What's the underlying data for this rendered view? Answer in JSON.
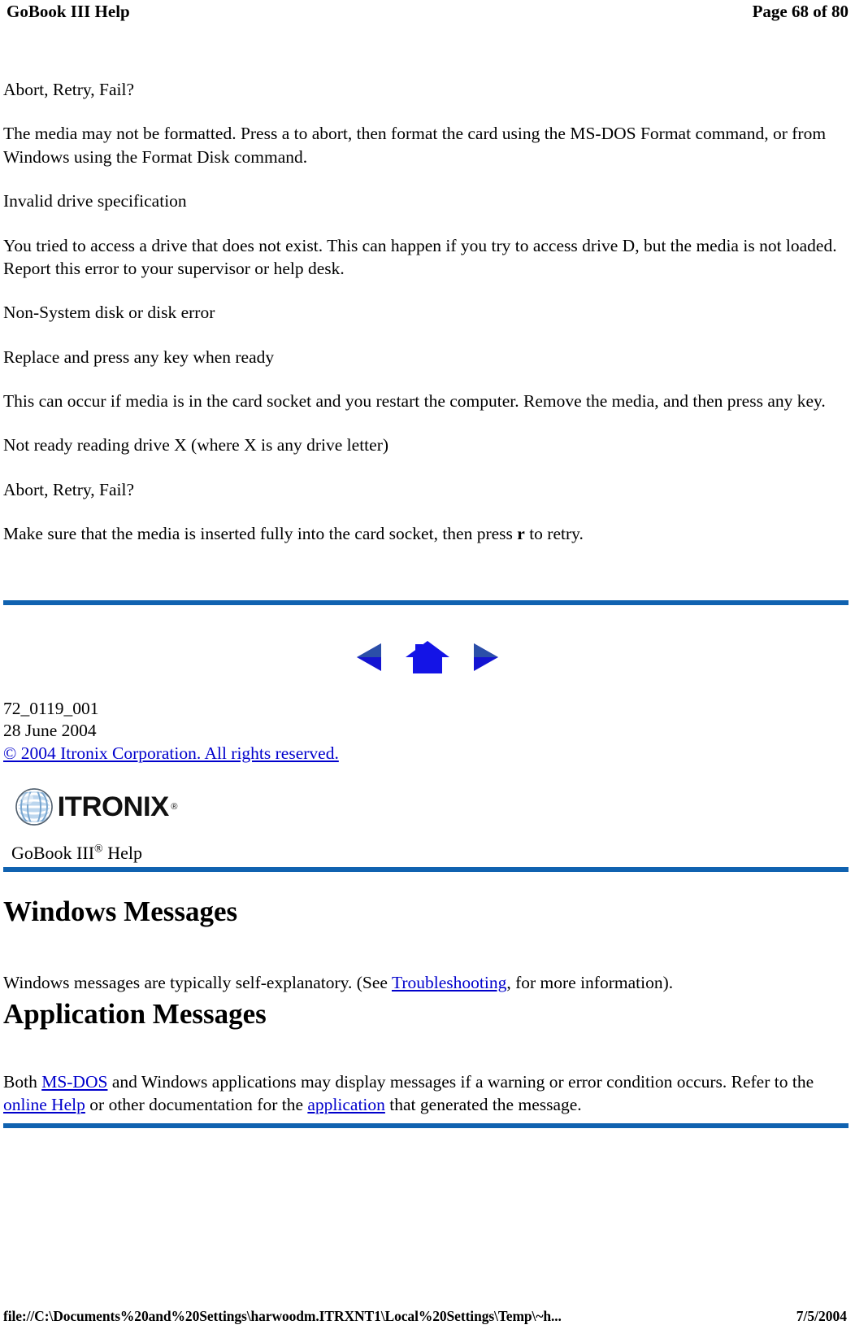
{
  "header": {
    "title": "GoBook III Help",
    "page_label": "Page 68 of 80"
  },
  "body_paragraphs": [
    {
      "id": "p1",
      "text": "Abort, Retry, Fail?"
    },
    {
      "id": "p2",
      "text": "The media may not be formatted. Press a to abort, then format the card using the MS-DOS Format command, or from Windows using the Format Disk command."
    },
    {
      "id": "p3",
      "text": "Invalid drive specification"
    },
    {
      "id": "p4",
      "text": "You tried to access a drive that does not exist. This can happen if you try to access drive D, but the media is not loaded. Report this error to your supervisor or help desk."
    },
    {
      "id": "p5",
      "text": "Non-System disk or disk error"
    },
    {
      "id": "p6",
      "text": "Replace and press any key when ready"
    },
    {
      "id": "p7",
      "text": "This can occur if media is in the card socket and you restart the computer. Remove the media, and then press any key."
    },
    {
      "id": "p8",
      "text": "Not ready reading drive X (where X is any drive letter)"
    },
    {
      "id": "p9",
      "text": "Abort, Retry, Fail?"
    }
  ],
  "retry_paragraph": {
    "before": "Make sure that the media is inserted fully into the card socket, then press ",
    "key": "r",
    "after": " to retry."
  },
  "navigation": {
    "back_icon": "back-triangle-icon",
    "home_icon": "home-house-icon",
    "forward_icon": "forward-triangle-icon"
  },
  "doc_id": {
    "part_number": "72_0119_001",
    "date": "28 June 2004",
    "copyright": "© 2004 Itronix Corporation.  All rights reserved."
  },
  "logo": {
    "globe_icon": "itronix-globe-icon",
    "wordmark": "ITRONIX",
    "registered_mark": "®"
  },
  "banner": {
    "product": "GoBook III",
    "superscript": "®",
    "suffix": " Help"
  },
  "sections": {
    "windows": {
      "heading": "Windows Messages",
      "text_before": "Windows messages are typically self-explanatory. (See ",
      "link": "Troubleshooting",
      "text_after": ", for more information)."
    },
    "application": {
      "heading": "Application Messages",
      "seg1": "Both ",
      "link1": "MS-DOS",
      "seg2": " and Windows applications may display messages if a warning or error condition occurs. Refer to the ",
      "link2": "online Help",
      "seg3": " or other documentation for the ",
      "link3": "application",
      "seg4": " that generated the message."
    }
  },
  "print_footer": {
    "file_path": "file://C:\\Documents%20and%20Settings\\harwoodm.ITRXNT1\\Local%20Settings\\Temp\\~h...",
    "date": "7/5/2004"
  },
  "colors": {
    "rule_blue": "#1062b0",
    "link_blue": "#0000cc",
    "nav_blue": "#1a1ae6"
  }
}
